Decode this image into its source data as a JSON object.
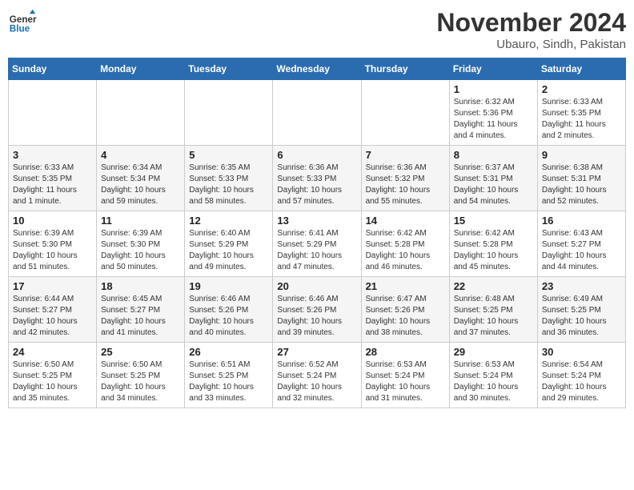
{
  "header": {
    "logo_line1": "General",
    "logo_line2": "Blue",
    "month_title": "November 2024",
    "subtitle": "Ubauro, Sindh, Pakistan"
  },
  "weekdays": [
    "Sunday",
    "Monday",
    "Tuesday",
    "Wednesday",
    "Thursday",
    "Friday",
    "Saturday"
  ],
  "weeks": [
    [
      {
        "day": "",
        "info": ""
      },
      {
        "day": "",
        "info": ""
      },
      {
        "day": "",
        "info": ""
      },
      {
        "day": "",
        "info": ""
      },
      {
        "day": "",
        "info": ""
      },
      {
        "day": "1",
        "info": "Sunrise: 6:32 AM\nSunset: 5:36 PM\nDaylight: 11 hours\nand 4 minutes."
      },
      {
        "day": "2",
        "info": "Sunrise: 6:33 AM\nSunset: 5:35 PM\nDaylight: 11 hours\nand 2 minutes."
      }
    ],
    [
      {
        "day": "3",
        "info": "Sunrise: 6:33 AM\nSunset: 5:35 PM\nDaylight: 11 hours\nand 1 minute."
      },
      {
        "day": "4",
        "info": "Sunrise: 6:34 AM\nSunset: 5:34 PM\nDaylight: 10 hours\nand 59 minutes."
      },
      {
        "day": "5",
        "info": "Sunrise: 6:35 AM\nSunset: 5:33 PM\nDaylight: 10 hours\nand 58 minutes."
      },
      {
        "day": "6",
        "info": "Sunrise: 6:36 AM\nSunset: 5:33 PM\nDaylight: 10 hours\nand 57 minutes."
      },
      {
        "day": "7",
        "info": "Sunrise: 6:36 AM\nSunset: 5:32 PM\nDaylight: 10 hours\nand 55 minutes."
      },
      {
        "day": "8",
        "info": "Sunrise: 6:37 AM\nSunset: 5:31 PM\nDaylight: 10 hours\nand 54 minutes."
      },
      {
        "day": "9",
        "info": "Sunrise: 6:38 AM\nSunset: 5:31 PM\nDaylight: 10 hours\nand 52 minutes."
      }
    ],
    [
      {
        "day": "10",
        "info": "Sunrise: 6:39 AM\nSunset: 5:30 PM\nDaylight: 10 hours\nand 51 minutes."
      },
      {
        "day": "11",
        "info": "Sunrise: 6:39 AM\nSunset: 5:30 PM\nDaylight: 10 hours\nand 50 minutes."
      },
      {
        "day": "12",
        "info": "Sunrise: 6:40 AM\nSunset: 5:29 PM\nDaylight: 10 hours\nand 49 minutes."
      },
      {
        "day": "13",
        "info": "Sunrise: 6:41 AM\nSunset: 5:29 PM\nDaylight: 10 hours\nand 47 minutes."
      },
      {
        "day": "14",
        "info": "Sunrise: 6:42 AM\nSunset: 5:28 PM\nDaylight: 10 hours\nand 46 minutes."
      },
      {
        "day": "15",
        "info": "Sunrise: 6:42 AM\nSunset: 5:28 PM\nDaylight: 10 hours\nand 45 minutes."
      },
      {
        "day": "16",
        "info": "Sunrise: 6:43 AM\nSunset: 5:27 PM\nDaylight: 10 hours\nand 44 minutes."
      }
    ],
    [
      {
        "day": "17",
        "info": "Sunrise: 6:44 AM\nSunset: 5:27 PM\nDaylight: 10 hours\nand 42 minutes."
      },
      {
        "day": "18",
        "info": "Sunrise: 6:45 AM\nSunset: 5:27 PM\nDaylight: 10 hours\nand 41 minutes."
      },
      {
        "day": "19",
        "info": "Sunrise: 6:46 AM\nSunset: 5:26 PM\nDaylight: 10 hours\nand 40 minutes."
      },
      {
        "day": "20",
        "info": "Sunrise: 6:46 AM\nSunset: 5:26 PM\nDaylight: 10 hours\nand 39 minutes."
      },
      {
        "day": "21",
        "info": "Sunrise: 6:47 AM\nSunset: 5:26 PM\nDaylight: 10 hours\nand 38 minutes."
      },
      {
        "day": "22",
        "info": "Sunrise: 6:48 AM\nSunset: 5:25 PM\nDaylight: 10 hours\nand 37 minutes."
      },
      {
        "day": "23",
        "info": "Sunrise: 6:49 AM\nSunset: 5:25 PM\nDaylight: 10 hours\nand 36 minutes."
      }
    ],
    [
      {
        "day": "24",
        "info": "Sunrise: 6:50 AM\nSunset: 5:25 PM\nDaylight: 10 hours\nand 35 minutes."
      },
      {
        "day": "25",
        "info": "Sunrise: 6:50 AM\nSunset: 5:25 PM\nDaylight: 10 hours\nand 34 minutes."
      },
      {
        "day": "26",
        "info": "Sunrise: 6:51 AM\nSunset: 5:25 PM\nDaylight: 10 hours\nand 33 minutes."
      },
      {
        "day": "27",
        "info": "Sunrise: 6:52 AM\nSunset: 5:24 PM\nDaylight: 10 hours\nand 32 minutes."
      },
      {
        "day": "28",
        "info": "Sunrise: 6:53 AM\nSunset: 5:24 PM\nDaylight: 10 hours\nand 31 minutes."
      },
      {
        "day": "29",
        "info": "Sunrise: 6:53 AM\nSunset: 5:24 PM\nDaylight: 10 hours\nand 30 minutes."
      },
      {
        "day": "30",
        "info": "Sunrise: 6:54 AM\nSunset: 5:24 PM\nDaylight: 10 hours\nand 29 minutes."
      }
    ]
  ]
}
